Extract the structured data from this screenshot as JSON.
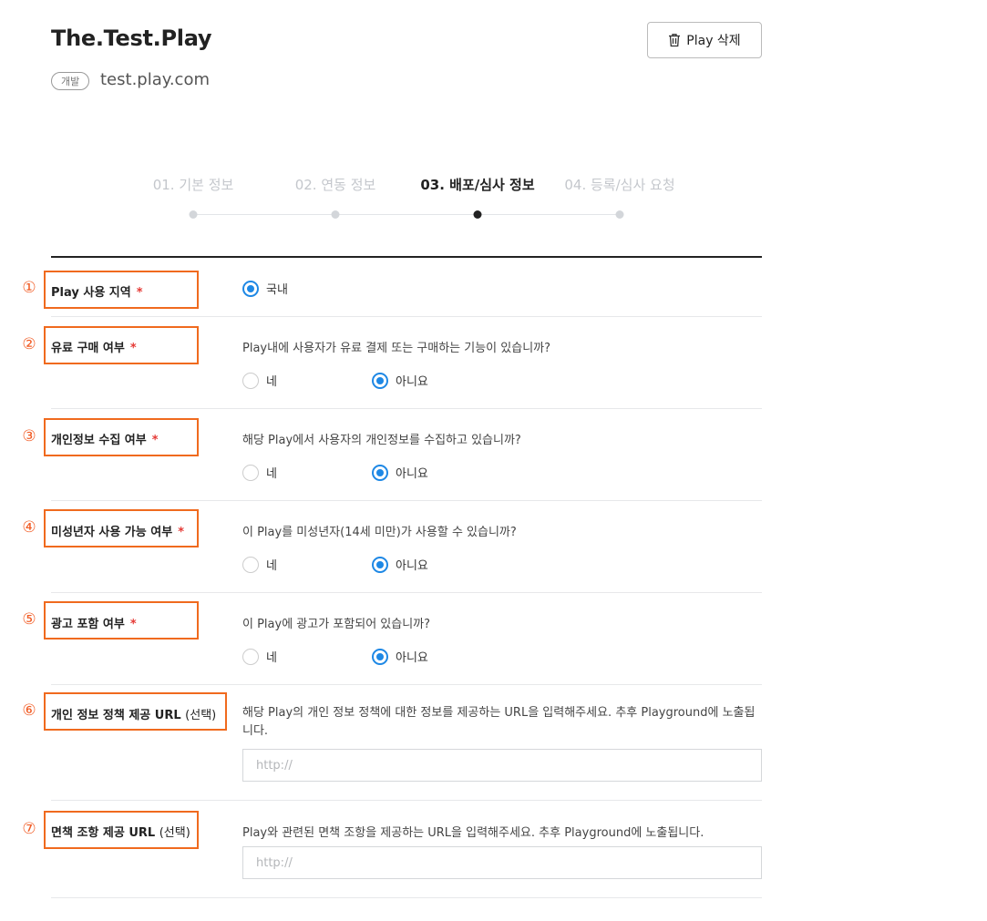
{
  "header": {
    "title": "The.Test.Play",
    "badge": "개발",
    "domain": "test.play.com",
    "delete_label": "Play 삭제"
  },
  "steps": [
    {
      "label": "01. 기본 정보",
      "active": false
    },
    {
      "label": "02. 연동 정보",
      "active": false
    },
    {
      "label": "03. 배포/심사 정보",
      "active": true
    },
    {
      "label": "04. 등록/심사 요청",
      "active": false
    }
  ],
  "form": {
    "required_mark": "*",
    "rows": [
      {
        "num": "①",
        "label": "Play 사용 지역",
        "options": [
          {
            "label": "국내",
            "selected": true
          }
        ]
      },
      {
        "num": "②",
        "label": "유료 구매 여부",
        "question": "Play내에 사용자가 유료 결제 또는 구매하는 기능이 있습니까?",
        "options": [
          {
            "label": "네",
            "selected": false
          },
          {
            "label": "아니요",
            "selected": true
          }
        ]
      },
      {
        "num": "③",
        "label": "개인정보 수집 여부",
        "question": "해당 Play에서 사용자의 개인정보를 수집하고 있습니까?",
        "options": [
          {
            "label": "네",
            "selected": false
          },
          {
            "label": "아니요",
            "selected": true
          }
        ]
      },
      {
        "num": "④",
        "label": "미성년자 사용 가능 여부",
        "question": "이 Play를 미성년자(14세 미만)가 사용할 수 있습니까?",
        "options": [
          {
            "label": "네",
            "selected": false
          },
          {
            "label": "아니요",
            "selected": true
          }
        ]
      },
      {
        "num": "⑤",
        "label": "광고 포함 여부",
        "question": "이 Play에 광고가 포함되어 있습니까?",
        "options": [
          {
            "label": "네",
            "selected": false
          },
          {
            "label": "아니요",
            "selected": true
          }
        ]
      },
      {
        "num": "⑥",
        "label": "개인 정보 정책 제공 URL",
        "label_suffix": "(선택)",
        "question": "해당 Play의 개인 정보 정책에 대한 정보를 제공하는 URL을 입력해주세요. 추후 Playground에 노출됩니다.",
        "placeholder": "http://",
        "value": ""
      },
      {
        "num": "⑦",
        "label": "면책 조항 제공 URL",
        "label_suffix": "(선택)",
        "question": "Play와 관련된 면책 조항을 제공하는 URL을 입력해주세요. 추후 Playground에 노출됩니다.",
        "placeholder": "http://",
        "value": ""
      }
    ]
  },
  "colors": {
    "accent": "#1e88e5",
    "highlight": "#f06a1e",
    "required": "#e53935"
  }
}
